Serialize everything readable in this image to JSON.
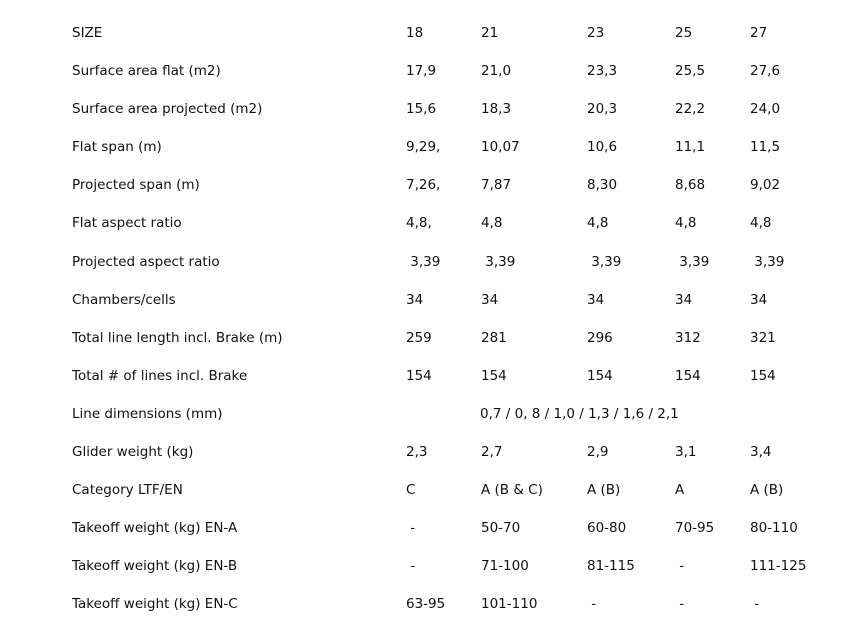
{
  "table": {
    "rows": [
      {
        "label": "SIZE",
        "values": [
          "18",
          "21",
          "23",
          "25",
          "27"
        ]
      },
      {
        "label": "Surface area flat (m2)",
        "values": [
          "17,9",
          "21,0",
          "23,3",
          "25,5",
          "27,6"
        ]
      },
      {
        "label": "Surface area projected (m2)",
        "values": [
          "15,6",
          "18,3",
          "20,3",
          "22,2",
          "24,0"
        ]
      },
      {
        "label": "Flat span (m)",
        "values": [
          "9,29,",
          "10,07",
          "10,6",
          "11,1",
          "11,5"
        ]
      },
      {
        "label": "Projected span (m)",
        "values": [
          "7,26,",
          "7,87",
          "8,30",
          "8,68",
          "9,02"
        ]
      },
      {
        "label": "Flat aspect ratio",
        "values": [
          "4,8,",
          "4,8",
          "4,8",
          "4,8",
          "4,8"
        ]
      },
      {
        "label": "Projected aspect ratio",
        "values": [
          " 3,39",
          " 3,39",
          " 3,39",
          " 3,39",
          " 3,39"
        ]
      },
      {
        "label": "Chambers/cells",
        "values": [
          "34",
          "34",
          "34",
          "34",
          "34"
        ]
      },
      {
        "label": "Total line length incl. Brake (m)",
        "values": [
          "259",
          "281",
          "296",
          "312",
          "321"
        ]
      },
      {
        "label": "Total # of lines incl. Brake",
        "values": [
          "154",
          "154",
          "154",
          "154",
          "154"
        ]
      },
      {
        "label": "Line dimensions (mm)",
        "span_value": "0,7 / 0, 8 / 1,0 / 1,3 / 1,6 / 2,1"
      },
      {
        "label": "Glider weight (kg)",
        "values": [
          "2,3",
          "2,7",
          "2,9",
          "3,1",
          "3,4"
        ]
      },
      {
        "label": "Category LTF/EN",
        "values": [
          "C",
          "A (B & C)",
          "A (B)",
          "A",
          "A (B)"
        ]
      },
      {
        "label": "Takeoff weight (kg) EN-A",
        "values": [
          " -",
          "50-70",
          "60-80",
          "70-95",
          "80-110"
        ]
      },
      {
        "label": "Takeoff weight (kg) EN-B",
        "values": [
          " -",
          "71-100",
          "81-115",
          " -",
          "111-125"
        ]
      },
      {
        "label": "Takeoff weight (kg) EN-C",
        "values": [
          "63-95",
          "101-110",
          " -",
          " -",
          " -"
        ]
      }
    ]
  }
}
